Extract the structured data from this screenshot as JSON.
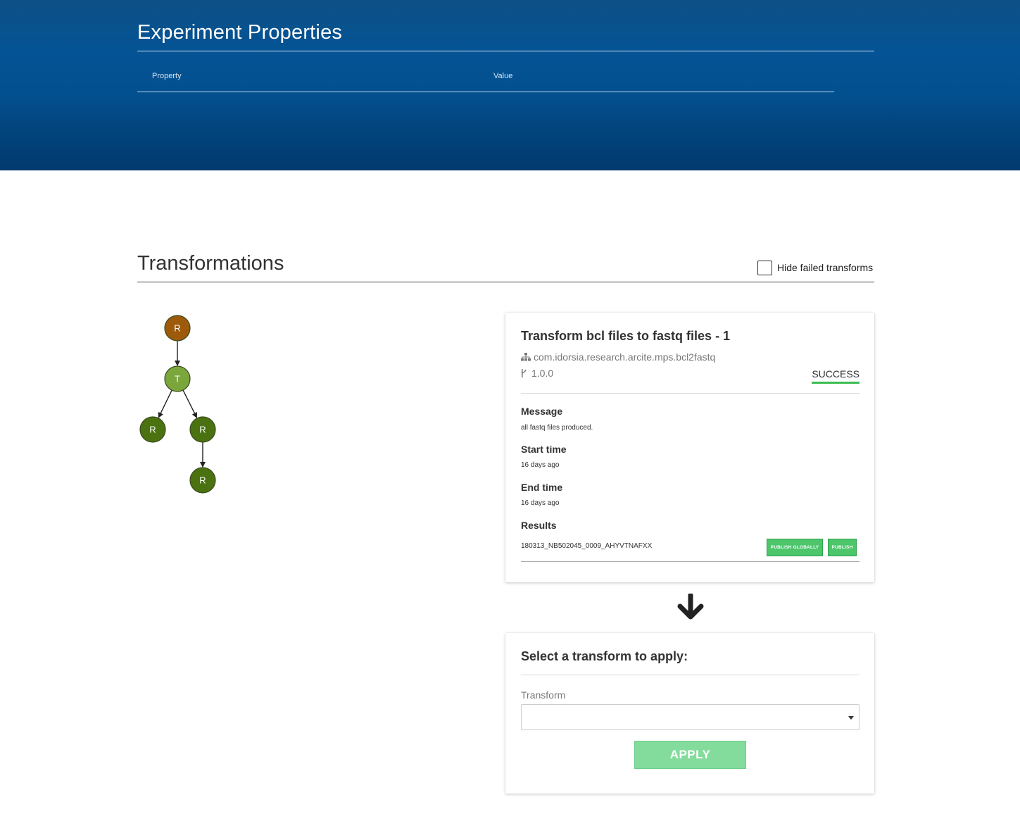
{
  "experiment_properties": {
    "title": "Experiment Properties",
    "columns": [
      "Property",
      "Value"
    ],
    "rows": []
  },
  "transformations": {
    "title": "Transformations",
    "hide_failed": {
      "label": "Hide failed transforms",
      "checked": false
    }
  },
  "graph": {
    "nodes": [
      {
        "id": "n1",
        "label": "R",
        "color": "#9c5a0a"
      },
      {
        "id": "n2",
        "label": "T",
        "color": "#7aa63c"
      },
      {
        "id": "n3",
        "label": "R",
        "color": "#4a7210"
      },
      {
        "id": "n4",
        "label": "R",
        "color": "#4a7210"
      },
      {
        "id": "n5",
        "label": "R",
        "color": "#4a7210"
      }
    ],
    "edges": [
      [
        "n1",
        "n2"
      ],
      [
        "n2",
        "n3"
      ],
      [
        "n2",
        "n4"
      ],
      [
        "n4",
        "n5"
      ]
    ]
  },
  "transform_detail": {
    "title": "Transform bcl files to fastq files - 1",
    "package_icon": "sitemap-icon",
    "package": "com.idorsia.research.arcite.mps.bcl2fastq",
    "version_icon": "branch-icon",
    "version": "1.0.0",
    "status": "SUCCESS",
    "status_color": "#3bbd52",
    "message_label": "Message",
    "message": "all fastq files produced.",
    "start_label": "Start time",
    "start": "16 days ago",
    "end_label": "End time",
    "end": "16 days ago",
    "results_label": "Results",
    "results": [
      {
        "name": "180313_NB502045_0009_AHYVTNAFXX",
        "publish_globally_label": "PUBLISH GLOBALLY",
        "publish_label": "PUBLISH"
      }
    ]
  },
  "apply_transform": {
    "title": "Select a transform to apply:",
    "field_label": "Transform",
    "selected": "",
    "button_label": "APPLY"
  },
  "colors": {
    "banner": "#045394",
    "success": "#3bbd52",
    "publish_button": "#4cc56b",
    "apply_button": "#84dc9c"
  }
}
